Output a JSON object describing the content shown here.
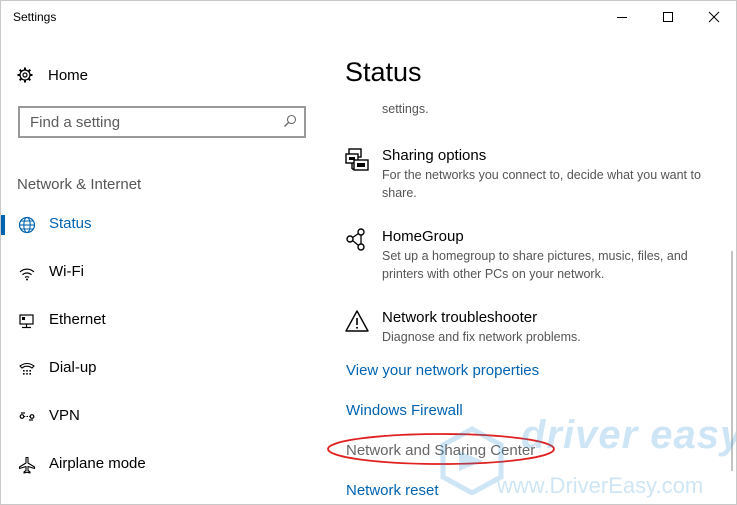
{
  "window": {
    "title": "Settings",
    "controls": {
      "minimize": "minimize-icon",
      "maximize": "maximize-icon",
      "close": "close-icon"
    }
  },
  "sidebar": {
    "home_label": "Home",
    "search_placeholder": "Find a setting",
    "section_title": "Network & Internet",
    "items": [
      {
        "label": "Status",
        "icon": "globe-icon",
        "active": true
      },
      {
        "label": "Wi-Fi",
        "icon": "wifi-icon",
        "active": false
      },
      {
        "label": "Ethernet",
        "icon": "ethernet-icon",
        "active": false
      },
      {
        "label": "Dial-up",
        "icon": "dialup-icon",
        "active": false
      },
      {
        "label": "VPN",
        "icon": "vpn-icon",
        "active": false
      },
      {
        "label": "Airplane mode",
        "icon": "airplane-icon",
        "active": false
      }
    ]
  },
  "main": {
    "title": "Status",
    "clipped_text": "settings.",
    "entries": [
      {
        "title": "Sharing options",
        "description": "For the networks you connect to, decide what you want to share.",
        "icon": "sharing-icon"
      },
      {
        "title": "HomeGroup",
        "description": "Set up a homegroup to share pictures, music, files, and printers with other PCs on your network.",
        "icon": "homegroup-icon"
      },
      {
        "title": "Network troubleshooter",
        "description": "Diagnose and fix network problems.",
        "icon": "warning-icon"
      }
    ],
    "links": [
      {
        "label": "View your network properties"
      },
      {
        "label": "Windows Firewall"
      },
      {
        "label": "Network and Sharing Center"
      },
      {
        "label": "Network reset"
      }
    ]
  },
  "watermark": {
    "text": "driver easy",
    "url": "www.DriverEasy.com"
  },
  "colors": {
    "accent": "#0063b1",
    "highlight_ellipse": "#e02020",
    "watermark": "#1f8dd6"
  }
}
